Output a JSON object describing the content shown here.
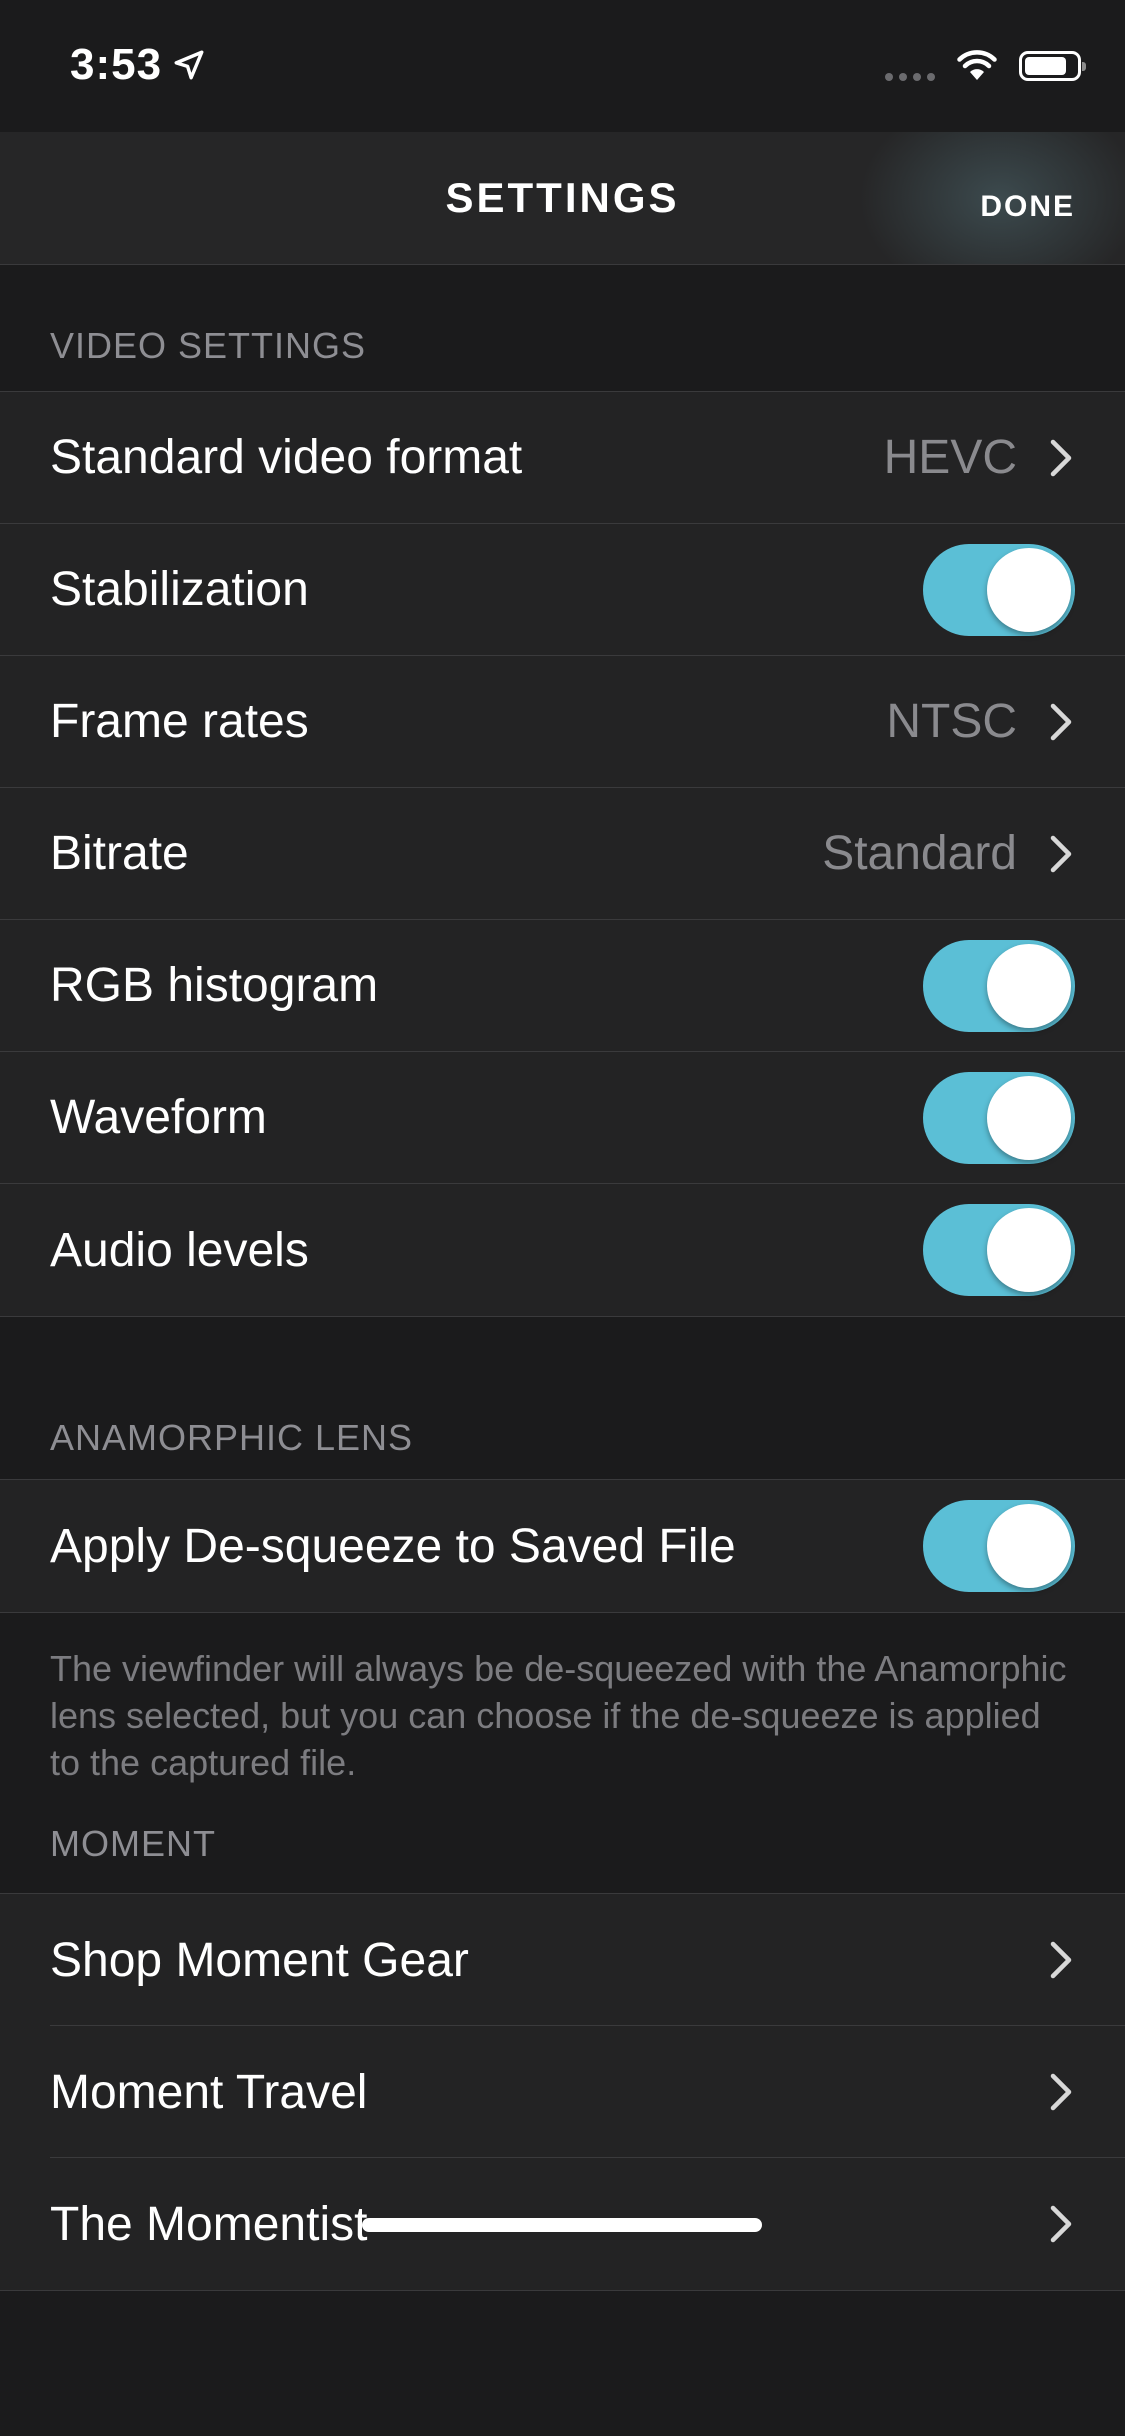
{
  "status_bar": {
    "time": "3:53",
    "location_icon": "location-arrow-icon",
    "wifi_icon": "wifi-icon",
    "battery_icon": "battery-icon"
  },
  "nav": {
    "title": "SETTINGS",
    "done_label": "DONE"
  },
  "video_settings": {
    "header": "VIDEO SETTINGS",
    "rows": [
      {
        "label": "Standard video format",
        "value": "HEVC",
        "type": "disclosure"
      },
      {
        "label": "Stabilization",
        "type": "toggle",
        "on": true
      },
      {
        "label": "Frame rates",
        "value": "NTSC",
        "type": "disclosure"
      },
      {
        "label": "Bitrate",
        "value": "Standard",
        "type": "disclosure"
      },
      {
        "label": "RGB histogram",
        "type": "toggle",
        "on": true
      },
      {
        "label": "Waveform",
        "type": "toggle",
        "on": true
      },
      {
        "label": "Audio levels",
        "type": "toggle",
        "on": true
      }
    ]
  },
  "anamorphic_lens": {
    "header": "ANAMORPHIC LENS",
    "rows": [
      {
        "label": "Apply De-squeeze to Saved File",
        "type": "toggle",
        "on": true
      }
    ],
    "footer": "The viewfinder will always be de-squeezed with the Anamorphic lens selected, but you can choose if the de-squeeze is applied to the captured file."
  },
  "moment": {
    "header": "MOMENT",
    "rows": [
      {
        "label": "Shop Moment Gear",
        "type": "disclosure"
      },
      {
        "label": "Moment Travel",
        "type": "disclosure"
      },
      {
        "label": "The Momentist",
        "type": "disclosure"
      }
    ]
  },
  "colors": {
    "background": "#1b1b1c",
    "cell": "#232324",
    "toggle_on": "#5bbfd6",
    "secondary_text": "#8a8a8e"
  }
}
